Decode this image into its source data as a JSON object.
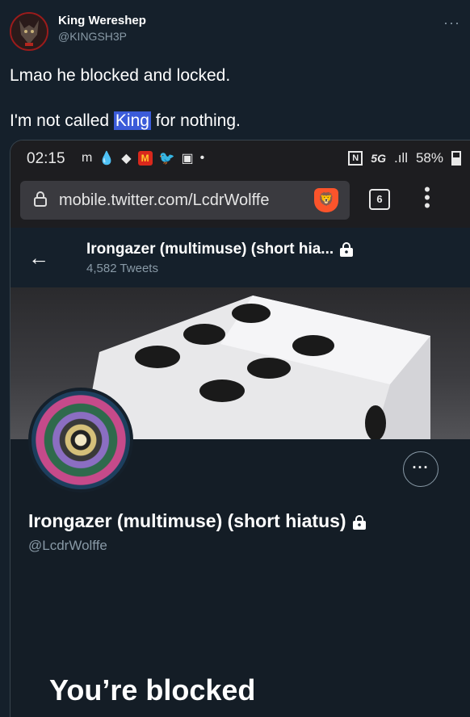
{
  "tweet": {
    "author_name": "King Wereshep",
    "author_handle": "@KINGSH3P",
    "more_icon": "more-horizontal-icon",
    "text_line1": "Lmao he blocked and locked.",
    "text_line2_before": "I'm not called ",
    "text_line2_highlight": "King",
    "text_line2_after": " for nothing."
  },
  "phone": {
    "time": "02:15",
    "status_icons": [
      "m",
      "drop-icon",
      "diamond-icon",
      "mcdonalds-icon",
      "twitter-bird-icon",
      "image-icon",
      "dot"
    ],
    "network": "5G",
    "battery": "58%",
    "url": "mobile.twitter.com/LcdrWolffe",
    "tab_count": "6"
  },
  "profile": {
    "header_title": "Irongazer (multimuse) (short hia...",
    "tweet_count": "4,582 Tweets",
    "display_name": "Irongazer (multimuse) (short hiatus)",
    "handle": "@LcdrWolffe",
    "blocked_message": "You’re blocked"
  },
  "colors": {
    "background": "#15202b",
    "secondary_text": "#8899a6",
    "highlight": "#3b5bd9",
    "avatar_border": "#9b1b1b"
  }
}
